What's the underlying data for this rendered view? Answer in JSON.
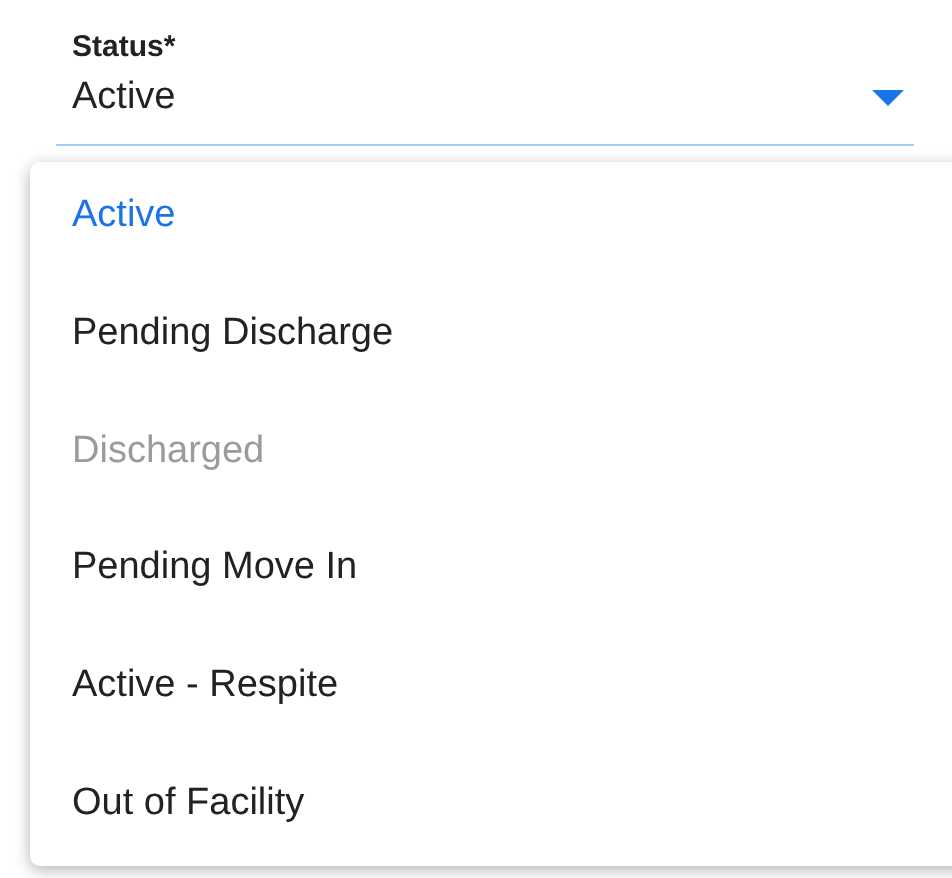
{
  "field": {
    "label": "Status*",
    "value": "Active"
  },
  "options": [
    {
      "label": "Active",
      "selected": true,
      "disabled": false
    },
    {
      "label": "Pending Discharge",
      "selected": false,
      "disabled": false
    },
    {
      "label": "Discharged",
      "selected": false,
      "disabled": true
    },
    {
      "label": "Pending Move In",
      "selected": false,
      "disabled": false
    },
    {
      "label": "Active - Respite",
      "selected": false,
      "disabled": false
    },
    {
      "label": "Out of Facility",
      "selected": false,
      "disabled": false
    }
  ]
}
